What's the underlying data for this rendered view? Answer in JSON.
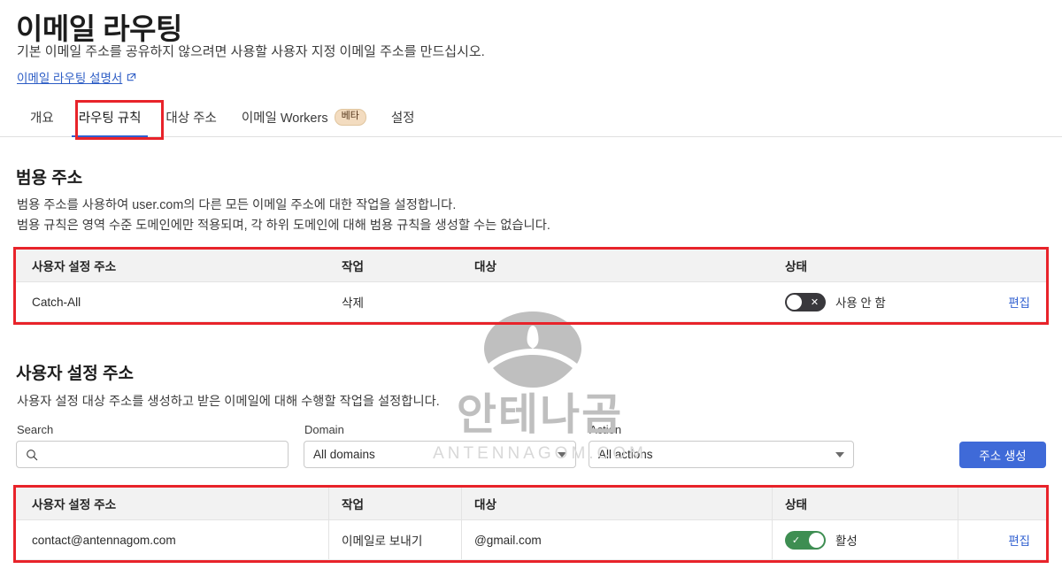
{
  "header": {
    "title": "이메일 라우팅",
    "subtitle": "기본 이메일 주소를 공유하지 않으려면 사용할 사용자 지정 이메일 주소를 만드십시오.",
    "doc_link": "이메일 라우팅 설명서"
  },
  "tabs": [
    {
      "label": "개요",
      "active": false
    },
    {
      "label": "라우팅 규칙",
      "active": true
    },
    {
      "label": "대상 주소",
      "active": false
    },
    {
      "label": "이메일 Workers",
      "badge": "베타",
      "active": false
    },
    {
      "label": "설정",
      "active": false
    }
  ],
  "catch_all": {
    "heading": "범용 주소",
    "desc_line1": "범용 주소를 사용하여 user.com의 다른 모든 이메일 주소에 대한 작업을 설정합니다.",
    "desc_line2": "범용 규칙은 영역 수준 도메인에만 적용되며, 각 하위 도메인에 대해 범용 규칙을 생성할 수는 없습니다.",
    "columns": {
      "address": "사용자 설정 주소",
      "action": "작업",
      "target": "대상",
      "status": "상태"
    },
    "row": {
      "address": "Catch-All",
      "action": "삭제",
      "target": "",
      "status_label": "사용 안 함",
      "status_on": false,
      "toggle_glyph": "✕",
      "edit": "편집"
    }
  },
  "custom": {
    "heading": "사용자 설정 주소",
    "desc": "사용자 설정 대상 주소를 생성하고 받은 이메일에 대해 수행할 작업을 설정합니다.",
    "filters": {
      "search_label": "Search",
      "search_value": "",
      "search_placeholder": "",
      "domain_label": "Domain",
      "domain_value": "All domains",
      "action_label": "Action",
      "action_value": "All actions",
      "create_button": "주소 생성"
    },
    "columns": {
      "address": "사용자 설정 주소",
      "action": "작업",
      "target": "대상",
      "status": "상태"
    },
    "rows": [
      {
        "address": "contact@antennagom.com",
        "action": "이메일로 보내기",
        "target": "@gmail.com",
        "status_label": "활성",
        "status_on": true,
        "toggle_glyph": "✓",
        "edit": "편집"
      }
    ]
  },
  "watermark": {
    "text_kr": "안테나곰",
    "text_en": "ANTENNAGOM.COM"
  },
  "colors": {
    "accent_blue": "#3f6ad8",
    "link_blue": "#2f5fd0",
    "highlight_red": "#e8232a",
    "toggle_on_green": "#3e8e52",
    "toggle_off_gray": "#39383c",
    "badge_beige": "#f3dcc0"
  }
}
